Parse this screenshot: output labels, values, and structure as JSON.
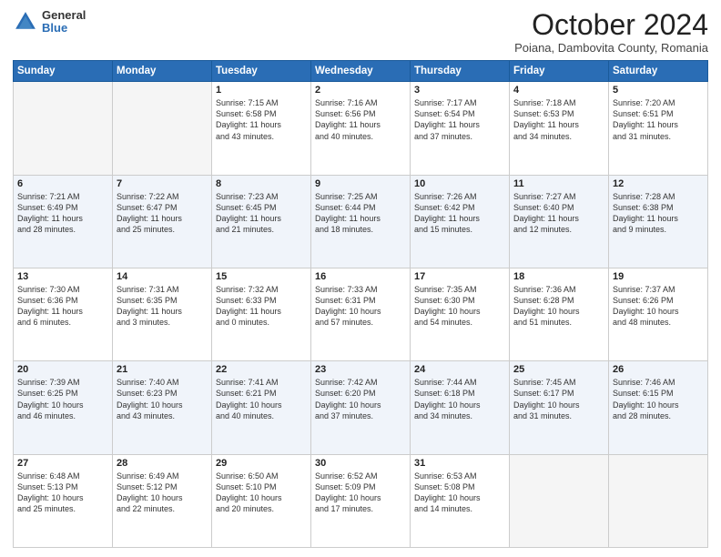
{
  "header": {
    "logo_general": "General",
    "logo_blue": "Blue",
    "month_title": "October 2024",
    "subtitle": "Poiana, Dambovita County, Romania"
  },
  "days_of_week": [
    "Sunday",
    "Monday",
    "Tuesday",
    "Wednesday",
    "Thursday",
    "Friday",
    "Saturday"
  ],
  "weeks": [
    [
      {
        "day": "",
        "empty": true
      },
      {
        "day": "",
        "empty": true
      },
      {
        "day": "1",
        "line1": "Sunrise: 7:15 AM",
        "line2": "Sunset: 6:58 PM",
        "line3": "Daylight: 11 hours",
        "line4": "and 43 minutes."
      },
      {
        "day": "2",
        "line1": "Sunrise: 7:16 AM",
        "line2": "Sunset: 6:56 PM",
        "line3": "Daylight: 11 hours",
        "line4": "and 40 minutes."
      },
      {
        "day": "3",
        "line1": "Sunrise: 7:17 AM",
        "line2": "Sunset: 6:54 PM",
        "line3": "Daylight: 11 hours",
        "line4": "and 37 minutes."
      },
      {
        "day": "4",
        "line1": "Sunrise: 7:18 AM",
        "line2": "Sunset: 6:53 PM",
        "line3": "Daylight: 11 hours",
        "line4": "and 34 minutes."
      },
      {
        "day": "5",
        "line1": "Sunrise: 7:20 AM",
        "line2": "Sunset: 6:51 PM",
        "line3": "Daylight: 11 hours",
        "line4": "and 31 minutes."
      }
    ],
    [
      {
        "day": "6",
        "line1": "Sunrise: 7:21 AM",
        "line2": "Sunset: 6:49 PM",
        "line3": "Daylight: 11 hours",
        "line4": "and 28 minutes."
      },
      {
        "day": "7",
        "line1": "Sunrise: 7:22 AM",
        "line2": "Sunset: 6:47 PM",
        "line3": "Daylight: 11 hours",
        "line4": "and 25 minutes."
      },
      {
        "day": "8",
        "line1": "Sunrise: 7:23 AM",
        "line2": "Sunset: 6:45 PM",
        "line3": "Daylight: 11 hours",
        "line4": "and 21 minutes."
      },
      {
        "day": "9",
        "line1": "Sunrise: 7:25 AM",
        "line2": "Sunset: 6:44 PM",
        "line3": "Daylight: 11 hours",
        "line4": "and 18 minutes."
      },
      {
        "day": "10",
        "line1": "Sunrise: 7:26 AM",
        "line2": "Sunset: 6:42 PM",
        "line3": "Daylight: 11 hours",
        "line4": "and 15 minutes."
      },
      {
        "day": "11",
        "line1": "Sunrise: 7:27 AM",
        "line2": "Sunset: 6:40 PM",
        "line3": "Daylight: 11 hours",
        "line4": "and 12 minutes."
      },
      {
        "day": "12",
        "line1": "Sunrise: 7:28 AM",
        "line2": "Sunset: 6:38 PM",
        "line3": "Daylight: 11 hours",
        "line4": "and 9 minutes."
      }
    ],
    [
      {
        "day": "13",
        "line1": "Sunrise: 7:30 AM",
        "line2": "Sunset: 6:36 PM",
        "line3": "Daylight: 11 hours",
        "line4": "and 6 minutes."
      },
      {
        "day": "14",
        "line1": "Sunrise: 7:31 AM",
        "line2": "Sunset: 6:35 PM",
        "line3": "Daylight: 11 hours",
        "line4": "and 3 minutes."
      },
      {
        "day": "15",
        "line1": "Sunrise: 7:32 AM",
        "line2": "Sunset: 6:33 PM",
        "line3": "Daylight: 11 hours",
        "line4": "and 0 minutes."
      },
      {
        "day": "16",
        "line1": "Sunrise: 7:33 AM",
        "line2": "Sunset: 6:31 PM",
        "line3": "Daylight: 10 hours",
        "line4": "and 57 minutes."
      },
      {
        "day": "17",
        "line1": "Sunrise: 7:35 AM",
        "line2": "Sunset: 6:30 PM",
        "line3": "Daylight: 10 hours",
        "line4": "and 54 minutes."
      },
      {
        "day": "18",
        "line1": "Sunrise: 7:36 AM",
        "line2": "Sunset: 6:28 PM",
        "line3": "Daylight: 10 hours",
        "line4": "and 51 minutes."
      },
      {
        "day": "19",
        "line1": "Sunrise: 7:37 AM",
        "line2": "Sunset: 6:26 PM",
        "line3": "Daylight: 10 hours",
        "line4": "and 48 minutes."
      }
    ],
    [
      {
        "day": "20",
        "line1": "Sunrise: 7:39 AM",
        "line2": "Sunset: 6:25 PM",
        "line3": "Daylight: 10 hours",
        "line4": "and 46 minutes."
      },
      {
        "day": "21",
        "line1": "Sunrise: 7:40 AM",
        "line2": "Sunset: 6:23 PM",
        "line3": "Daylight: 10 hours",
        "line4": "and 43 minutes."
      },
      {
        "day": "22",
        "line1": "Sunrise: 7:41 AM",
        "line2": "Sunset: 6:21 PM",
        "line3": "Daylight: 10 hours",
        "line4": "and 40 minutes."
      },
      {
        "day": "23",
        "line1": "Sunrise: 7:42 AM",
        "line2": "Sunset: 6:20 PM",
        "line3": "Daylight: 10 hours",
        "line4": "and 37 minutes."
      },
      {
        "day": "24",
        "line1": "Sunrise: 7:44 AM",
        "line2": "Sunset: 6:18 PM",
        "line3": "Daylight: 10 hours",
        "line4": "and 34 minutes."
      },
      {
        "day": "25",
        "line1": "Sunrise: 7:45 AM",
        "line2": "Sunset: 6:17 PM",
        "line3": "Daylight: 10 hours",
        "line4": "and 31 minutes."
      },
      {
        "day": "26",
        "line1": "Sunrise: 7:46 AM",
        "line2": "Sunset: 6:15 PM",
        "line3": "Daylight: 10 hours",
        "line4": "and 28 minutes."
      }
    ],
    [
      {
        "day": "27",
        "line1": "Sunrise: 6:48 AM",
        "line2": "Sunset: 5:13 PM",
        "line3": "Daylight: 10 hours",
        "line4": "and 25 minutes."
      },
      {
        "day": "28",
        "line1": "Sunrise: 6:49 AM",
        "line2": "Sunset: 5:12 PM",
        "line3": "Daylight: 10 hours",
        "line4": "and 22 minutes."
      },
      {
        "day": "29",
        "line1": "Sunrise: 6:50 AM",
        "line2": "Sunset: 5:10 PM",
        "line3": "Daylight: 10 hours",
        "line4": "and 20 minutes."
      },
      {
        "day": "30",
        "line1": "Sunrise: 6:52 AM",
        "line2": "Sunset: 5:09 PM",
        "line3": "Daylight: 10 hours",
        "line4": "and 17 minutes."
      },
      {
        "day": "31",
        "line1": "Sunrise: 6:53 AM",
        "line2": "Sunset: 5:08 PM",
        "line3": "Daylight: 10 hours",
        "line4": "and 14 minutes."
      },
      {
        "day": "",
        "empty": true
      },
      {
        "day": "",
        "empty": true
      }
    ]
  ]
}
